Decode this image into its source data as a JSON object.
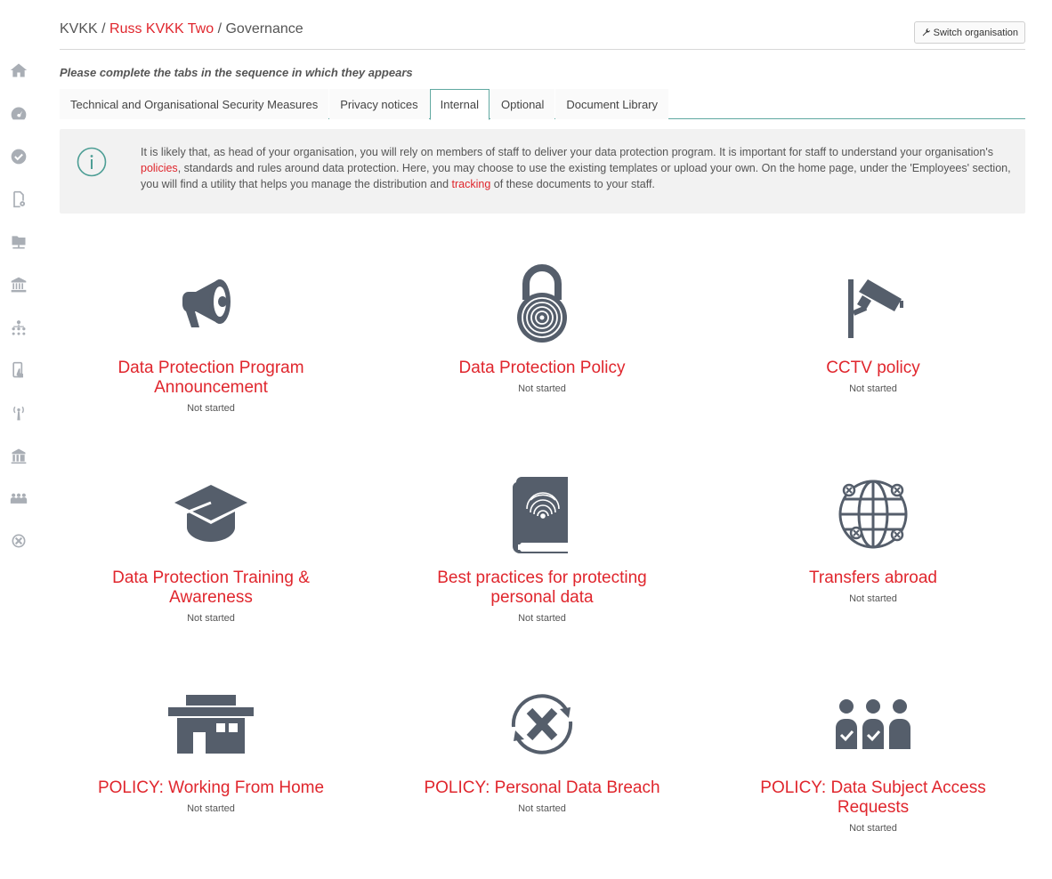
{
  "colors": {
    "accent": "#e0262d",
    "icon": "#555e6b",
    "sidebar_icon": "#a9aeb5",
    "tab_border": "#5fa8a0"
  },
  "sidebar": {
    "items": [
      {
        "name": "home-icon"
      },
      {
        "name": "dashboard-icon"
      },
      {
        "name": "check-circle-icon"
      },
      {
        "name": "document-settings-icon"
      },
      {
        "name": "folder-network-icon"
      },
      {
        "name": "institution-icon"
      },
      {
        "name": "org-chart-icon"
      },
      {
        "name": "mobile-touch-icon"
      },
      {
        "name": "broadcast-tower-icon"
      },
      {
        "name": "building-icon"
      },
      {
        "name": "people-check-icon"
      },
      {
        "name": "breach-icon"
      }
    ]
  },
  "header": {
    "crumb1": "KVKK",
    "sep": " / ",
    "crumb2": "Russ KVKK Two",
    "crumb3": "Governance",
    "switch_label": "Switch organisation"
  },
  "instruction": "Please complete the tabs in the sequence in which they appears",
  "tabs": [
    {
      "label": "Technical and Organisational Security Measures"
    },
    {
      "label": "Privacy notices"
    },
    {
      "label": "Internal"
    },
    {
      "label": "Optional"
    },
    {
      "label": "Document Library"
    }
  ],
  "info": {
    "t1": "It is likely that, as head of your organisation, you will rely on members of staff to deliver your data protection program. It is important for staff to understand your organisation's ",
    "link1": "policies",
    "t2": ", standards and rules around data protection. Here, you may choose to use the existing templates or upload your own. On the home page, under the 'Employees' section, you will find a utility that helps you manage the distribution and ",
    "link2": "tracking",
    "t3": " of these documents to your staff."
  },
  "cards": [
    {
      "title": "Data Protection Program Announcement",
      "status": "Not started",
      "icon": "megaphone-icon"
    },
    {
      "title": "Data Protection Policy",
      "status": "Not started",
      "icon": "fingerprint-lock-icon"
    },
    {
      "title": "CCTV policy",
      "status": "Not started",
      "icon": "cctv-camera-icon"
    },
    {
      "title": "Data Protection Training & Awareness",
      "status": "Not started",
      "icon": "graduation-cap-icon"
    },
    {
      "title": "Best practices for protecting personal data",
      "status": "Not started",
      "icon": "fingerprint-book-icon"
    },
    {
      "title": "Transfers abroad",
      "status": "Not started",
      "icon": "globe-icon"
    },
    {
      "title": "POLICY: Working From Home",
      "status": "Not started",
      "icon": "house-icon"
    },
    {
      "title": "POLICY: Personal Data Breach",
      "status": "Not started",
      "icon": "breach-cross-icon"
    },
    {
      "title": "POLICY: Data Subject Access Requests",
      "status": "Not started",
      "icon": "people-check-icon"
    }
  ]
}
